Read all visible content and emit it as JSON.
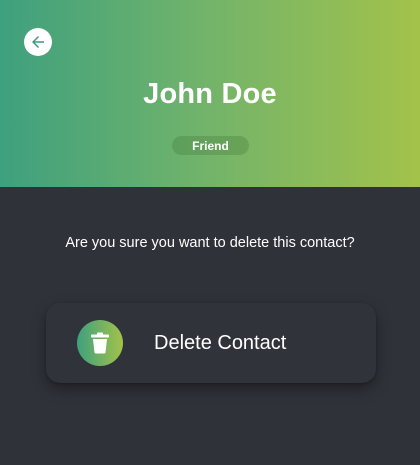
{
  "header": {
    "back_icon": "arrow-left-icon",
    "contact_name": "John Doe",
    "badge_label": "Friend"
  },
  "confirm": {
    "question": "Are you sure you want to delete this contact?",
    "delete_label": "Delete Contact",
    "delete_icon": "trash-icon"
  },
  "colors": {
    "gradient_start": "#3ea07e",
    "gradient_end": "#a3c24a",
    "background": "#2f3238",
    "text": "#ffffff"
  }
}
